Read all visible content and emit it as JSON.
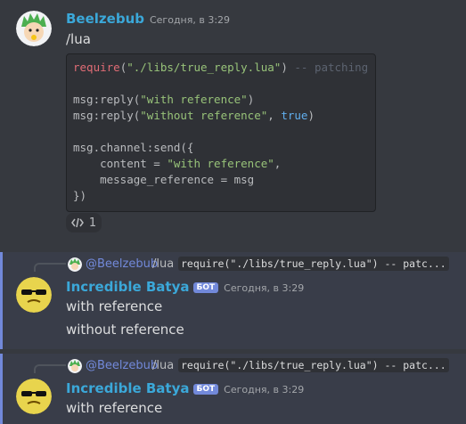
{
  "message1": {
    "author": "Beelzebub",
    "author_color": "#3ba8d9",
    "timestamp": "Сегодня, в 3:29",
    "content": "/lua",
    "code": {
      "l1_fn": "require",
      "l1_open": "(",
      "l1_str": "\"./libs/true_reply.lua\"",
      "l1_close": ")",
      "l1_cmt": "-- patching",
      "l2_pre": "msg:reply(",
      "l2_str": "\"with reference\"",
      "l2_post": ")",
      "l3_pre": "msg:reply(",
      "l3_str": "\"without reference\"",
      "l3_mid": ", ",
      "l3_bool": "true",
      "l3_post": ")",
      "l4": "msg.channel:send({",
      "l5_pre": "    content = ",
      "l5_str": "\"with reference\"",
      "l5_post": ",",
      "l6": "    message_reference = msg",
      "l7": "})"
    },
    "reaction": {
      "icon": "code-icon",
      "count": "1"
    }
  },
  "reply_block1": {
    "reply_mention": "@Beelzebub",
    "reply_cmd": "/lua",
    "reply_snippet": "require(\"./libs/true_reply.lua\") -- patc...",
    "author": "Incredible Batya",
    "author_color": "#3ba8d9",
    "bot_badge": "БОТ",
    "timestamp": "Сегодня, в 3:29",
    "content": "with reference",
    "followup": "without reference"
  },
  "reply_block2": {
    "reply_mention": "@Beelzebub",
    "reply_cmd": "/lua",
    "reply_snippet": "require(\"./libs/true_reply.lua\") -- patc...",
    "author": "Incredible Batya",
    "author_color": "#3ba8d9",
    "bot_badge": "БОТ",
    "timestamp": "Сегодня, в 3:29",
    "content": "with reference"
  }
}
